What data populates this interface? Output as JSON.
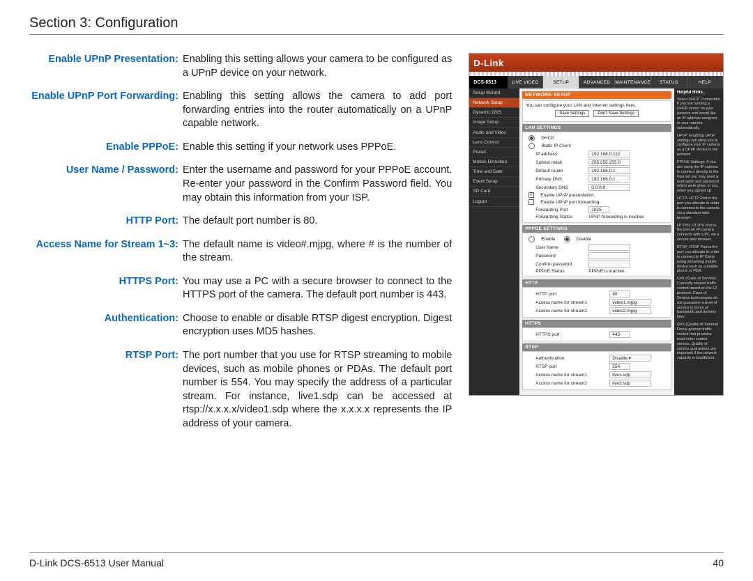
{
  "header": {
    "title": "Section 3: Configuration"
  },
  "definitions": [
    {
      "term": "Enable UPnP Presentation:",
      "desc": "Enabling this setting allows your camera to be configured as a UPnP device on your network."
    },
    {
      "term": "Enable UPnP Port Forwarding:",
      "desc": "Enabling this setting allows the camera to add port forwarding entries into the router automatically on a UPnP capable network."
    },
    {
      "term": "Enable PPPoE:",
      "desc": "Enable this setting if your network uses PPPoE."
    },
    {
      "term": "User Name / Password:",
      "desc": "Enter the username and password for your PPPoE account. Re-enter your password in the Confirm Password field. You may obtain this information from your ISP."
    },
    {
      "term": "HTTP Port:",
      "desc": "The default port number is 80."
    },
    {
      "term": "Access Name for Stream 1~3:",
      "desc": "The default name is video#.mjpg, where # is the number of the stream."
    },
    {
      "term": "HTTPS Port:",
      "desc": "You may use a PC with a secure browser to connect to the HTTPS port of the camera. The default port number is 443."
    },
    {
      "term": "Authentication:",
      "desc": "Choose to enable or disable RTSP digest encryption. Digest encryption uses MD5 hashes."
    },
    {
      "term": "RTSP Port:",
      "desc": "The port number that you use for RTSP streaming to mobile devices, such as mobile phones or PDAs. The default port number is 554. You may specify the address of a particular stream. For instance, live1.sdp can be accessed at rtsp://x.x.x.x/video1.sdp where the x.x.x.x represents the IP address of your camera."
    }
  ],
  "shot": {
    "brand": "D-Link",
    "model": "DCS-6513",
    "tabs": [
      "LIVE VIDEO",
      "SETUP",
      "ADVANCED",
      "MAINTENANCE",
      "STATUS",
      "HELP"
    ],
    "sidebar": [
      "Setup Wizard",
      "Network Setup",
      "Dynamic DNS",
      "Image Setup",
      "Audio and Video",
      "Lens Control",
      "Preset",
      "Motion Detection",
      "Time and Date",
      "Event Setup",
      "SD Card",
      "Logout"
    ],
    "panel_title": "NETWORK SETUP",
    "panel_desc": "You can configure your LAN and Internet settings here.",
    "btn_save": "Save Settings",
    "btn_dont": "Don't Save Settings",
    "lan_head": "LAN SETTINGS",
    "dhcp": "DHCP",
    "static": "Static IP Client",
    "rows": {
      "ip": {
        "k": "IP address",
        "v": "192.168.0.112"
      },
      "mask": {
        "k": "Subnet mask",
        "v": "255.255.255.0"
      },
      "gw": {
        "k": "Default router",
        "v": "192.168.0.1"
      },
      "dns1": {
        "k": "Primary DNS",
        "v": "192.168.0.1"
      },
      "dns2": {
        "k": "Secondary DNS",
        "v": "0.0.0.0"
      }
    },
    "upnp_pres": "Enable UPnP presentation",
    "upnp_fwd": "Enable UPnP port forwarding",
    "fwd_port": {
      "k": "Forwarding Port",
      "v": "1025"
    },
    "fwd_status": {
      "k": "Forwarding Status",
      "v": "UPnP forwarding is inactive"
    },
    "pppoe_head": "PPPOE SETTINGS",
    "pppoe_enable": "Enable",
    "pppoe_disable": "Disable",
    "pppoe_user": "User Name",
    "pppoe_pass": "Password",
    "pppoe_conf": "Confirm password",
    "pppoe_status": {
      "k": "PPPoE Status",
      "v": "PPPoE is inactive."
    },
    "http_head": "HTTP",
    "http_port": {
      "k": "HTTP port",
      "v": "80"
    },
    "an1": {
      "k": "Access name for stream1",
      "v": "video1.mjpg"
    },
    "an2": {
      "k": "Access name for stream2",
      "v": "video2.mjpg"
    },
    "https_head": "HTTPS",
    "https_port": {
      "k": "HTTPS port",
      "v": "443"
    },
    "rtsp_head": "RTSP",
    "auth": {
      "k": "Authentication",
      "v": "Disable ▾"
    },
    "rtsp_port": {
      "k": "RTSP port",
      "v": "554"
    },
    "rn1": {
      "k": "Access name for stream1",
      "v": "live1.sdp"
    },
    "rn2": {
      "k": "Access name for stream2",
      "v": "live2.sdp"
    },
    "help_title": "Helpful Hints..",
    "help_paras": [
      "Select DHCP Connection if you are running a DHCP server on your network and would like an IP address assigned to your camera automatically.",
      "UPnP: Enabling UPnP settings will allow you to configure your IP camera as a UPnP device in the network.",
      "PPPoE Settings: If you are using the IP camera to connect directly to the Internet you may need a username and password which were given to you when you signed up.",
      "HTTP: HTTP Port is the port you allocate in order to connect to the camera via a standard web browser.",
      "HTTPS: HTTPS Port is the port an IP camera connects with a PC via a secure web browser.",
      "RTSP: RTSP Port is the port you allocate in order to connect to IP Cams using streaming mobile device such as a mobile phone or PDA.",
      "CoS (Class of Service): Currently several traffic control based on the L2 protocol. Class of Service technologies do not guarantee a level of service in terms of bandwidth and delivery time.",
      "QoS (Quality of Service): Finely-grained traffic control that provides read order control service. Quality of service guarantees are important if the network capacity is insufficient."
    ]
  },
  "footer": {
    "left": "D-Link DCS-6513 User Manual",
    "right": "40"
  }
}
